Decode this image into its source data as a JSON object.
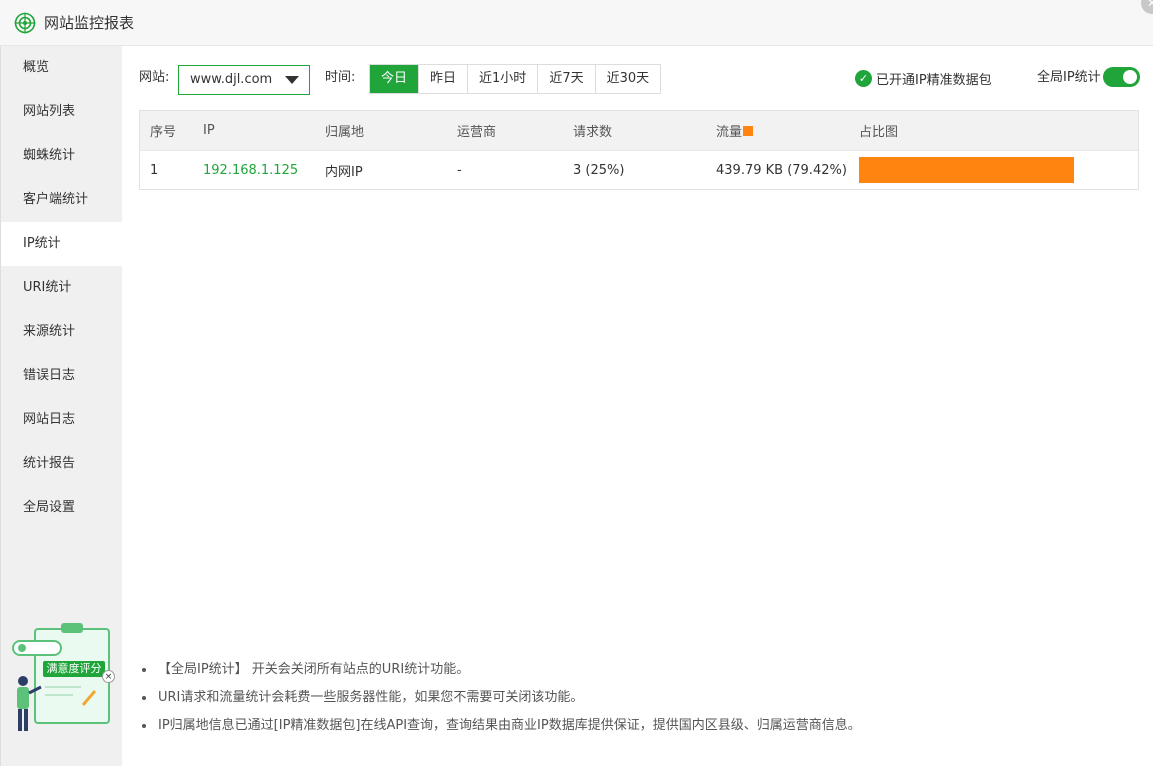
{
  "window": {
    "title": "网站监控报表",
    "close_glyph": "✕"
  },
  "sidebar": {
    "items": [
      {
        "label": "概览",
        "active": false
      },
      {
        "label": "网站列表",
        "active": false
      },
      {
        "label": "蜘蛛统计",
        "active": false
      },
      {
        "label": "客户端统计",
        "active": false
      },
      {
        "label": "IP统计",
        "active": true
      },
      {
        "label": "URI统计",
        "active": false
      },
      {
        "label": "来源统计",
        "active": false
      },
      {
        "label": "错误日志",
        "active": false
      },
      {
        "label": "网站日志",
        "active": false
      },
      {
        "label": "统计报告",
        "active": false
      },
      {
        "label": "全局设置",
        "active": false
      }
    ],
    "survey": {
      "label": "满意度评分",
      "close_glyph": "×"
    }
  },
  "filters": {
    "site_label": "网站:",
    "site_value": "www.djl.com",
    "time_label": "时间:",
    "time_tabs": [
      {
        "label": "今日",
        "active": true
      },
      {
        "label": "昨日",
        "active": false
      },
      {
        "label": "近1小时",
        "active": false
      },
      {
        "label": "近7天",
        "active": false
      },
      {
        "label": "近30天",
        "active": false
      }
    ],
    "ip_pack_status": "已开通IP精准数据包",
    "global_ip_label": "全局IP统计",
    "global_ip_enabled": true
  },
  "table": {
    "columns": [
      "序号",
      "IP",
      "归属地",
      "运营商",
      "请求数",
      "流量",
      "占比图"
    ],
    "rows": [
      {
        "index": "1",
        "ip": "192.168.1.125",
        "location": "内网IP",
        "isp": "-",
        "requests": "3 (25%)",
        "traffic": "439.79 KB (79.42%)",
        "share": 0.9942
      }
    ]
  },
  "notes": [
    "【全局IP统计】 开关会关闭所有站点的URI统计功能。",
    "URI请求和流量统计会耗费一些服务器性能，如果您不需要可关闭该功能。",
    "IP归属地信息已通过[IP精准数据包]在线API查询，查询结果由商业IP数据库提供保证，提供国内区县级、归属运营商信息。"
  ],
  "colors": {
    "accent": "#20a53a",
    "bar": "#ff8410"
  },
  "icons": {
    "app": "monitor-target-icon",
    "check": "check-circle-icon",
    "dropdown": "caret-down-icon"
  }
}
